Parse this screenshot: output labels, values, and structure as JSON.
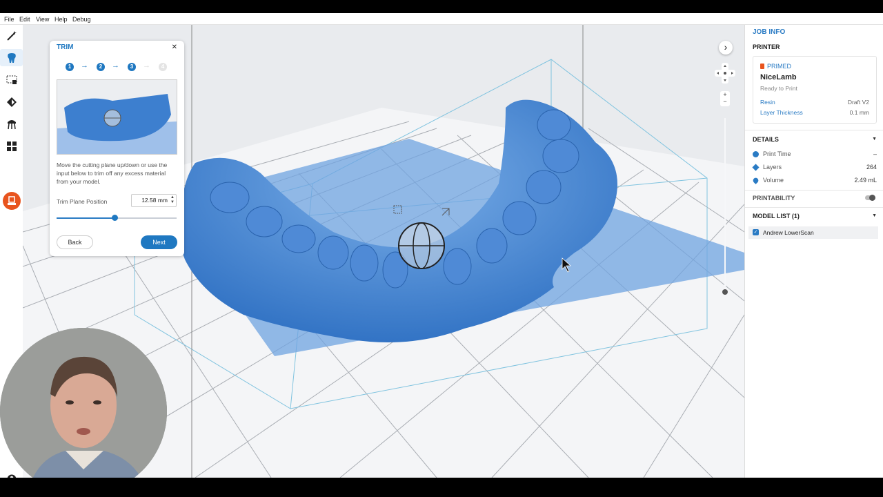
{
  "menu": [
    "File",
    "Edit",
    "View",
    "Help",
    "Debug"
  ],
  "toolbar": {
    "items": [
      "magic-wand-icon",
      "tooth-icon",
      "select-box-icon",
      "orient-icon",
      "supports-icon",
      "layout-icon",
      "print-icon"
    ],
    "bottom_icon": "account-icon"
  },
  "trim": {
    "title": "TRIM",
    "close": "✕",
    "steps": [
      "1",
      "2",
      "3",
      "4"
    ],
    "arrow": "→",
    "instruction": "Move the cutting plane up/down or use the input below to trim off any excess material from your model.",
    "position_label": "Trim Plane Position",
    "position_value": "12.58 mm",
    "slider_fraction": 0.48,
    "back": "Back",
    "next": "Next"
  },
  "view_controls": {
    "expand": "›",
    "zoom_in": "+",
    "zoom_out": "−",
    "plane_slider_fraction": 0.0
  },
  "job_info": {
    "title": "JOB INFO",
    "printer_heading": "PRINTER",
    "printer_status": "PRIMED",
    "printer_name": "NiceLamb",
    "printer_state": "Ready to Print",
    "resin_label": "Resin",
    "resin_value": "Draft V2",
    "layer_label": "Layer Thickness",
    "layer_value": "0.1 mm",
    "details_heading": "DETAILS",
    "print_time_label": "Print Time",
    "print_time_value": "–",
    "layers_label": "Layers",
    "layers_value": "264",
    "volume_label": "Volume",
    "volume_value": "2.49 mL",
    "printability_heading": "PRINTABILITY",
    "model_list_heading": "MODEL LIST (1)",
    "models": [
      "Andrew LowerScan"
    ]
  },
  "colors": {
    "accent": "#1f78c1",
    "model": "#3d7fcf",
    "plane": "#6fa3e0",
    "orange": "#e8541e"
  }
}
